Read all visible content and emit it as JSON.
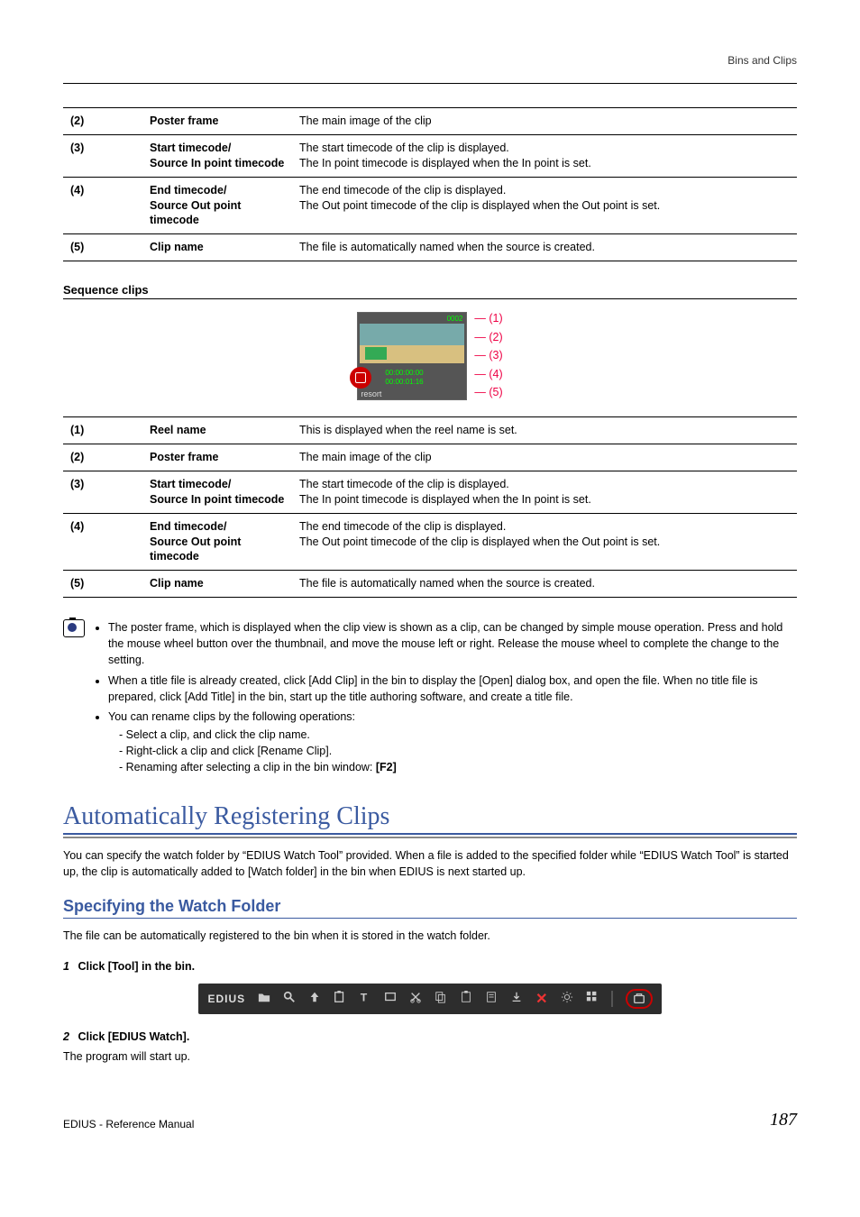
{
  "header": {
    "section_label": "Bins and Clips"
  },
  "table_top": [
    {
      "num": "(2)",
      "label": "Poster frame",
      "desc": "The main image of the clip"
    },
    {
      "num": "(3)",
      "label": "Start timecode/\nSource In point timecode",
      "desc": "The start timecode of the clip is displayed.\nThe In point timecode is displayed when the In point is set."
    },
    {
      "num": "(4)",
      "label": "End timecode/\nSource Out point timecode",
      "desc": "The end timecode of the clip is displayed.\nThe Out point timecode of the clip is displayed when the Out point is set."
    },
    {
      "num": "(5)",
      "label": "Clip name",
      "desc": "The file is automatically named when the source is created."
    }
  ],
  "seq_heading": "Sequence clips",
  "thumb": {
    "reel": "0002",
    "tc1": "00:00:00:00",
    "tc2": "00:00:01:16",
    "name": "resort"
  },
  "callouts": [
    "(1)",
    "(2)",
    "(3)",
    "(4)",
    "(5)"
  ],
  "table_seq": [
    {
      "num": "(1)",
      "label": "Reel name",
      "desc": "This is displayed when the reel name is set."
    },
    {
      "num": "(2)",
      "label": "Poster frame",
      "desc": "The main image of the clip"
    },
    {
      "num": "(3)",
      "label": "Start timecode/\nSource In point timecode",
      "desc": "The start timecode of the clip is displayed.\nThe In point timecode is displayed when the In point is set."
    },
    {
      "num": "(4)",
      "label": "End timecode/\nSource Out point timecode",
      "desc": "The end timecode of the clip is displayed.\nThe Out point timecode of the clip is displayed when the Out point is set."
    },
    {
      "num": "(5)",
      "label": "Clip name",
      "desc": "The file is automatically named when the source is created."
    }
  ],
  "notes": {
    "bullet1": "The poster frame, which is displayed when the clip view is shown as a clip, can be changed by simple mouse operation. Press and hold the mouse wheel button over the thumbnail, and move the mouse left or right. Release the mouse wheel to complete the change to the setting.",
    "bullet2": "When a title file is already created, click [Add Clip] in the bin to display the [Open] dialog box, and open the file. When no title file is prepared, click [Add Title] in the bin, start up the title authoring software, and create a title file.",
    "bullet3": "You can rename clips by the following operations:",
    "sub1": "Select a clip, and click the clip name.",
    "sub2": "Right-click a clip and click [Rename Clip].",
    "sub3_prefix": "Renaming after selecting a clip in the bin window: ",
    "sub3_key": "[F2]"
  },
  "section_title": "Automatically Registering Clips",
  "section_body": "You can specify the watch folder by “EDIUS Watch Tool” provided. When a file is added to the specified folder while “EDIUS Watch Tool” is started up, the clip is automatically added to [Watch folder] in the bin when EDIUS is next started up.",
  "sub_title": "Specifying the Watch Folder",
  "sub_body": "The file can be automatically registered to the bin when it is stored in the watch folder.",
  "steps": {
    "s1_num": "1",
    "s1_label": "Click [Tool] in the bin.",
    "s2_num": "2",
    "s2_label": "Click [EDIUS Watch].",
    "s2_after": "The program will start up."
  },
  "toolbar": {
    "brand": "EDIUS"
  },
  "footer": {
    "left": "EDIUS - Reference Manual",
    "page": "187"
  }
}
